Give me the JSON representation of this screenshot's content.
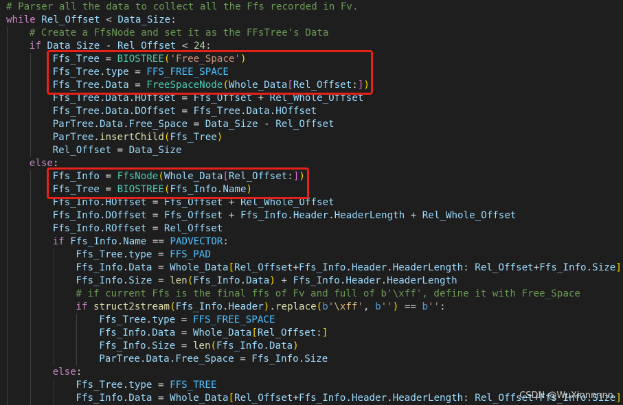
{
  "watermark": "CSDN @WuXinnnnnn",
  "colors": {
    "background": "#1e1e1e",
    "highlight_box": "#e8201a"
  },
  "lines": [
    {
      "indent": 0,
      "tokens": [
        [
          "cmt",
          "# Parser all the data to collect all the Ffs recorded in Fv."
        ]
      ]
    },
    {
      "indent": 0,
      "tokens": [
        [
          "ctl",
          "while"
        ],
        [
          "op",
          " "
        ],
        [
          "var",
          "Rel_Offset"
        ],
        [
          "op",
          " < "
        ],
        [
          "var",
          "Data_Size"
        ],
        [
          "op",
          ":"
        ]
      ]
    },
    {
      "indent": 1,
      "tokens": [
        [
          "cmt",
          "# Create a FfsNode and set it as the FFsTree's Data"
        ]
      ]
    },
    {
      "indent": 1,
      "tokens": [
        [
          "ctl",
          "if"
        ],
        [
          "op",
          " "
        ],
        [
          "var",
          "Data_Size"
        ],
        [
          "op",
          " - "
        ],
        [
          "var",
          "Rel_Offset"
        ],
        [
          "op",
          " < "
        ],
        [
          "num",
          "24"
        ],
        [
          "op",
          ":"
        ]
      ]
    },
    {
      "indent": 2,
      "tokens": [
        [
          "var",
          "Ffs_Tree"
        ],
        [
          "op",
          " = "
        ],
        [
          "cls",
          "BIOSTREE"
        ],
        [
          "br1",
          "("
        ],
        [
          "str",
          "'Free_Space'"
        ],
        [
          "br1",
          ")"
        ]
      ]
    },
    {
      "indent": 2,
      "tokens": [
        [
          "var",
          "Ffs_Tree"
        ],
        [
          "op",
          "."
        ],
        [
          "var",
          "type"
        ],
        [
          "op",
          " = "
        ],
        [
          "const",
          "FFS_FREE_SPACE"
        ]
      ]
    },
    {
      "indent": 2,
      "tokens": [
        [
          "var",
          "Ffs_Tree"
        ],
        [
          "op",
          "."
        ],
        [
          "var",
          "Data"
        ],
        [
          "op",
          " = "
        ],
        [
          "cls",
          "FreeSpaceNode"
        ],
        [
          "br1",
          "("
        ],
        [
          "var",
          "Whole_Data"
        ],
        [
          "br2",
          "["
        ],
        [
          "var",
          "Rel_Offset"
        ],
        [
          "op",
          ":"
        ],
        [
          "br2",
          "]"
        ],
        [
          "br1",
          ")"
        ]
      ]
    },
    {
      "indent": 2,
      "tokens": [
        [
          "var",
          "Ffs_Tree"
        ],
        [
          "op",
          "."
        ],
        [
          "var",
          "Data"
        ],
        [
          "op",
          "."
        ],
        [
          "var",
          "HOffset"
        ],
        [
          "op",
          " = "
        ],
        [
          "var",
          "Ffs_Offset"
        ],
        [
          "op",
          " + "
        ],
        [
          "var",
          "Rel_Whole_Offset"
        ]
      ]
    },
    {
      "indent": 2,
      "tokens": [
        [
          "var",
          "Ffs_Tree"
        ],
        [
          "op",
          "."
        ],
        [
          "var",
          "Data"
        ],
        [
          "op",
          "."
        ],
        [
          "var",
          "DOffset"
        ],
        [
          "op",
          " = "
        ],
        [
          "var",
          "Ffs_Tree"
        ],
        [
          "op",
          "."
        ],
        [
          "var",
          "Data"
        ],
        [
          "op",
          "."
        ],
        [
          "var",
          "HOffset"
        ]
      ]
    },
    {
      "indent": 2,
      "tokens": [
        [
          "var",
          "ParTree"
        ],
        [
          "op",
          "."
        ],
        [
          "var",
          "Data"
        ],
        [
          "op",
          "."
        ],
        [
          "var",
          "Free_Space"
        ],
        [
          "op",
          " = "
        ],
        [
          "var",
          "Data_Size"
        ],
        [
          "op",
          " - "
        ],
        [
          "var",
          "Rel_Offset"
        ]
      ]
    },
    {
      "indent": 2,
      "tokens": [
        [
          "var",
          "ParTree"
        ],
        [
          "op",
          "."
        ],
        [
          "fn",
          "insertChild"
        ],
        [
          "br1",
          "("
        ],
        [
          "var",
          "Ffs_Tree"
        ],
        [
          "br1",
          ")"
        ]
      ]
    },
    {
      "indent": 2,
      "tokens": [
        [
          "var",
          "Rel_Offset"
        ],
        [
          "op",
          " = "
        ],
        [
          "var",
          "Data_Size"
        ]
      ]
    },
    {
      "indent": 1,
      "tokens": [
        [
          "ctl",
          "else"
        ],
        [
          "op",
          ":"
        ]
      ]
    },
    {
      "indent": 2,
      "tokens": [
        [
          "var",
          "Ffs_Info"
        ],
        [
          "op",
          " = "
        ],
        [
          "cls",
          "FfsNode"
        ],
        [
          "br1",
          "("
        ],
        [
          "var",
          "Whole_Data"
        ],
        [
          "br2",
          "["
        ],
        [
          "var",
          "Rel_Offset"
        ],
        [
          "op",
          ":"
        ],
        [
          "br2",
          "]"
        ],
        [
          "br1",
          ")"
        ]
      ]
    },
    {
      "indent": 2,
      "tokens": [
        [
          "var",
          "Ffs_Tree"
        ],
        [
          "op",
          " = "
        ],
        [
          "cls",
          "BIOSTREE"
        ],
        [
          "br1",
          "("
        ],
        [
          "var",
          "Ffs_Info"
        ],
        [
          "op",
          "."
        ],
        [
          "var",
          "Name"
        ],
        [
          "br1",
          ")"
        ]
      ]
    },
    {
      "indent": 2,
      "tokens": [
        [
          "var",
          "Ffs_Info"
        ],
        [
          "op",
          "."
        ],
        [
          "var",
          "HOffset"
        ],
        [
          "op",
          " = "
        ],
        [
          "var",
          "Ffs_Offset"
        ],
        [
          "op",
          " + "
        ],
        [
          "var",
          "Rel_Whole_Offset"
        ]
      ]
    },
    {
      "indent": 2,
      "tokens": [
        [
          "var",
          "Ffs_Info"
        ],
        [
          "op",
          "."
        ],
        [
          "var",
          "DOffset"
        ],
        [
          "op",
          " = "
        ],
        [
          "var",
          "Ffs_Offset"
        ],
        [
          "op",
          " + "
        ],
        [
          "var",
          "Ffs_Info"
        ],
        [
          "op",
          "."
        ],
        [
          "var",
          "Header"
        ],
        [
          "op",
          "."
        ],
        [
          "var",
          "HeaderLength"
        ],
        [
          "op",
          " + "
        ],
        [
          "var",
          "Rel_Whole_Offset"
        ]
      ]
    },
    {
      "indent": 2,
      "tokens": [
        [
          "var",
          "Ffs_Info"
        ],
        [
          "op",
          "."
        ],
        [
          "var",
          "ROffset"
        ],
        [
          "op",
          " = "
        ],
        [
          "var",
          "Rel_Offset"
        ]
      ]
    },
    {
      "indent": 2,
      "tokens": [
        [
          "ctl",
          "if"
        ],
        [
          "op",
          " "
        ],
        [
          "var",
          "Ffs_Info"
        ],
        [
          "op",
          "."
        ],
        [
          "var",
          "Name"
        ],
        [
          "op",
          " == "
        ],
        [
          "const",
          "PADVECTOR"
        ],
        [
          "op",
          ":"
        ]
      ]
    },
    {
      "indent": 3,
      "tokens": [
        [
          "var",
          "Ffs_Tree"
        ],
        [
          "op",
          "."
        ],
        [
          "var",
          "type"
        ],
        [
          "op",
          " = "
        ],
        [
          "const",
          "FFS_PAD"
        ]
      ]
    },
    {
      "indent": 3,
      "tokens": [
        [
          "var",
          "Ffs_Info"
        ],
        [
          "op",
          "."
        ],
        [
          "var",
          "Data"
        ],
        [
          "op",
          " = "
        ],
        [
          "var",
          "Whole_Data"
        ],
        [
          "br1",
          "["
        ],
        [
          "var",
          "Rel_Offset"
        ],
        [
          "op",
          "+"
        ],
        [
          "var",
          "Ffs_Info"
        ],
        [
          "op",
          "."
        ],
        [
          "var",
          "Header"
        ],
        [
          "op",
          "."
        ],
        [
          "var",
          "HeaderLength"
        ],
        [
          "op",
          ": "
        ],
        [
          "var",
          "Rel_Offset"
        ],
        [
          "op",
          "+"
        ],
        [
          "var",
          "Ffs_Info"
        ],
        [
          "op",
          "."
        ],
        [
          "var",
          "Size"
        ],
        [
          "br1",
          "]"
        ]
      ]
    },
    {
      "indent": 3,
      "tokens": [
        [
          "var",
          "Ffs_Info"
        ],
        [
          "op",
          "."
        ],
        [
          "var",
          "Size"
        ],
        [
          "op",
          " = "
        ],
        [
          "fn",
          "len"
        ],
        [
          "br1",
          "("
        ],
        [
          "var",
          "Ffs_Info"
        ],
        [
          "op",
          "."
        ],
        [
          "var",
          "Data"
        ],
        [
          "br1",
          ")"
        ],
        [
          "op",
          " + "
        ],
        [
          "var",
          "Ffs_Info"
        ],
        [
          "op",
          "."
        ],
        [
          "var",
          "Header"
        ],
        [
          "op",
          "."
        ],
        [
          "var",
          "HeaderLength"
        ]
      ]
    },
    {
      "indent": 3,
      "tokens": [
        [
          "cmt",
          "# if current Ffs is the final ffs of Fv and full of b'\\xff', define it with Free_Space"
        ]
      ]
    },
    {
      "indent": 3,
      "tokens": [
        [
          "ctl",
          "if"
        ],
        [
          "op",
          " "
        ],
        [
          "fn",
          "struct2stream"
        ],
        [
          "br1",
          "("
        ],
        [
          "var",
          "Ffs_Info"
        ],
        [
          "op",
          "."
        ],
        [
          "var",
          "Header"
        ],
        [
          "br1",
          ")"
        ],
        [
          "op",
          "."
        ],
        [
          "fn",
          "replace"
        ],
        [
          "br1",
          "("
        ],
        [
          "kw",
          "b"
        ],
        [
          "str",
          "'"
        ],
        [
          "esc",
          "\\xff"
        ],
        [
          "str",
          "'"
        ],
        [
          "op",
          ", "
        ],
        [
          "kw",
          "b"
        ],
        [
          "str",
          "''"
        ],
        [
          "br1",
          ")"
        ],
        [
          "op",
          " == "
        ],
        [
          "kw",
          "b"
        ],
        [
          "str",
          "''"
        ],
        [
          "op",
          ":"
        ]
      ]
    },
    {
      "indent": 4,
      "tokens": [
        [
          "var",
          "Ffs_Tree"
        ],
        [
          "op",
          "."
        ],
        [
          "var",
          "type"
        ],
        [
          "op",
          " = "
        ],
        [
          "const",
          "FFS_FREE_SPACE"
        ]
      ]
    },
    {
      "indent": 4,
      "tokens": [
        [
          "var",
          "Ffs_Info"
        ],
        [
          "op",
          "."
        ],
        [
          "var",
          "Data"
        ],
        [
          "op",
          " = "
        ],
        [
          "var",
          "Whole_Data"
        ],
        [
          "br1",
          "["
        ],
        [
          "var",
          "Rel_Offset"
        ],
        [
          "op",
          ":"
        ],
        [
          "br1",
          "]"
        ]
      ]
    },
    {
      "indent": 4,
      "tokens": [
        [
          "var",
          "Ffs_Info"
        ],
        [
          "op",
          "."
        ],
        [
          "var",
          "Size"
        ],
        [
          "op",
          " = "
        ],
        [
          "fn",
          "len"
        ],
        [
          "br1",
          "("
        ],
        [
          "var",
          "Ffs_Info"
        ],
        [
          "op",
          "."
        ],
        [
          "var",
          "Data"
        ],
        [
          "br1",
          ")"
        ]
      ]
    },
    {
      "indent": 4,
      "tokens": [
        [
          "var",
          "ParTree"
        ],
        [
          "op",
          "."
        ],
        [
          "var",
          "Data"
        ],
        [
          "op",
          "."
        ],
        [
          "var",
          "Free_Space"
        ],
        [
          "op",
          " = "
        ],
        [
          "var",
          "Ffs_Info"
        ],
        [
          "op",
          "."
        ],
        [
          "var",
          "Size"
        ]
      ]
    },
    {
      "indent": 2,
      "tokens": [
        [
          "ctl",
          "else"
        ],
        [
          "op",
          ":"
        ]
      ]
    },
    {
      "indent": 3,
      "tokens": [
        [
          "var",
          "Ffs_Tree"
        ],
        [
          "op",
          "."
        ],
        [
          "var",
          "type"
        ],
        [
          "op",
          " = "
        ],
        [
          "const",
          "FFS_TREE"
        ]
      ]
    },
    {
      "indent": 3,
      "tokens": [
        [
          "var",
          "Ffs_Info"
        ],
        [
          "op",
          "."
        ],
        [
          "var",
          "Data"
        ],
        [
          "op",
          " = "
        ],
        [
          "var",
          "Whole_Data"
        ],
        [
          "br1",
          "["
        ],
        [
          "var",
          "Rel_Offset"
        ],
        [
          "op",
          "+"
        ],
        [
          "var",
          "Ffs_Info"
        ],
        [
          "op",
          "."
        ],
        [
          "var",
          "Header"
        ],
        [
          "op",
          "."
        ],
        [
          "var",
          "HeaderLength"
        ],
        [
          "op",
          ": "
        ],
        [
          "var",
          "Rel_Offset"
        ],
        [
          "op",
          "+"
        ],
        [
          "var",
          "Ffs_Info"
        ],
        [
          "op",
          "."
        ],
        [
          "var",
          "Size"
        ],
        [
          "br1",
          "]"
        ]
      ]
    }
  ],
  "highlighted_ranges": [
    {
      "from_line": 5,
      "to_line": 7
    },
    {
      "from_line": 14,
      "to_line": 15
    }
  ]
}
